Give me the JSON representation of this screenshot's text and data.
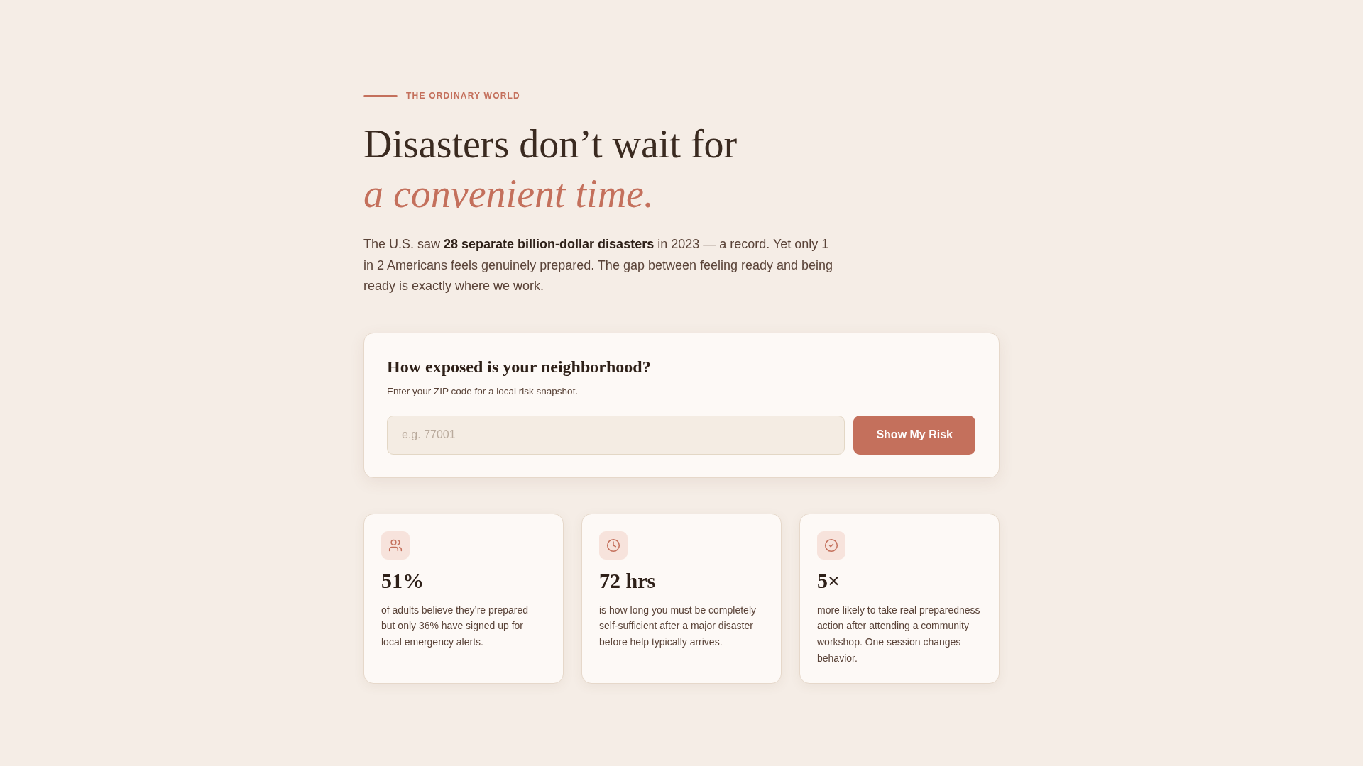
{
  "eyebrow": "THE ORDINARY WORLD",
  "headline": "Disasters don’t wait for *a convenient time.*",
  "intro": "The U.S. saw **28 separate billion-dollar disasters** in 2023 — a record. Yet only 1 in 2 Americans feels genuinely prepared. The gap between feeling ready and being ready is exactly where we work.",
  "risk_check": {
    "title": "How exposed is your neighborhood?",
    "subtitle": "Enter your ZIP code for a local risk snapshot.",
    "zip_field": {
      "placeholder": "e.g. 77001"
    },
    "button": "Show My Risk"
  },
  "stats": [
    {
      "value": "51%",
      "description": "of adults believe they’re prepared — but only 36% have signed up for local emergency alerts."
    },
    {
      "value": "72 hrs",
      "description": "is how long you must be completely self-sufficient after a major disaster before help typically arrives."
    },
    {
      "value": "5×",
      "description": "more likely to take real preparedness action after attending a community workshop. One session changes behavior."
    }
  ]
}
